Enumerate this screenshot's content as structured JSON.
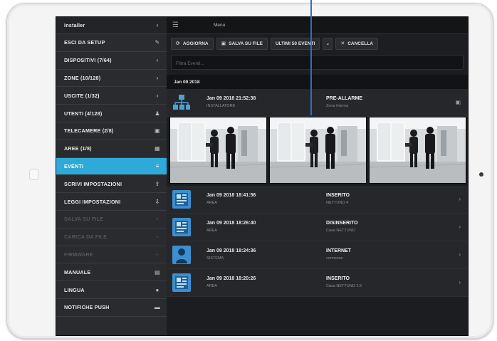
{
  "sidebar": {
    "header": "Installer",
    "items": [
      {
        "label": "ESCI DA SETUP",
        "icon": "tools-icon",
        "glyph": "✎",
        "state": "normal"
      },
      {
        "label": "DISPOSITIVI (7/64)",
        "icon": "chevron-right-icon",
        "glyph": "›",
        "state": "normal"
      },
      {
        "label": "ZONE (10/128)",
        "icon": "chevron-right-icon",
        "glyph": "›",
        "state": "normal"
      },
      {
        "label": "USCITE (1/32)",
        "icon": "chevron-right-icon",
        "glyph": "›",
        "state": "normal"
      },
      {
        "label": "UTENTI (4/128)",
        "icon": "user-icon",
        "glyph": "♟",
        "state": "normal"
      },
      {
        "label": "TELECAMERE (2/8)",
        "icon": "camera-icon",
        "glyph": "▣",
        "state": "normal"
      },
      {
        "label": "AREE (1/8)",
        "icon": "grid-icon",
        "glyph": "▦",
        "state": "normal"
      },
      {
        "label": "EVENTI",
        "icon": "list-icon",
        "glyph": "≡",
        "state": "active"
      },
      {
        "label": "SCRIVI IMPOSTAZIONI",
        "icon": "upload-icon",
        "glyph": "⇪",
        "state": "normal"
      },
      {
        "label": "LEGGI IMPOSTAZIONI",
        "icon": "download-icon",
        "glyph": "⇩",
        "state": "normal"
      },
      {
        "label": "SALVA SU FILE",
        "icon": "save-icon",
        "glyph": "▪",
        "state": "disabled"
      },
      {
        "label": "CARICA DA FILE",
        "icon": "folder-icon",
        "glyph": "▪",
        "state": "disabled"
      },
      {
        "label": "FIRMWARE",
        "icon": "chip-icon",
        "glyph": "▪",
        "state": "disabled"
      },
      {
        "label": "MANUALE",
        "icon": "book-icon",
        "glyph": "▤",
        "state": "normal"
      },
      {
        "label": "LINGUA",
        "icon": "globe-icon",
        "glyph": "●",
        "state": "normal"
      },
      {
        "label": "NOTIFICHE PUSH",
        "icon": "bubble-icon",
        "glyph": "▬",
        "state": "normal"
      }
    ]
  },
  "topbar": {
    "title": "Menu",
    "menu_icon": "hamburger-icon"
  },
  "toolbar": {
    "refresh_label": "AGGIORNA",
    "save_label": "SALVA SU FILE",
    "last_events_label": "ULTIMI 50 EVENTI",
    "delete_label": "CANCELLA"
  },
  "filter": {
    "placeholder": "Filtra Eventi..."
  },
  "date_header": "Jan 09 2018",
  "events": [
    {
      "time": "Jan 09 2018 21:52:38",
      "who": "INSTALLATORE",
      "type": "PRE-ALLARME",
      "sub": "Zona Interna",
      "icon": "alarm-network-icon",
      "has_photos": true
    },
    {
      "time": "Jan 09 2018 18:41:56",
      "who": "AREA",
      "type": "INSERITO",
      "sub": "NETTUNO 4",
      "icon": "panel-icon"
    },
    {
      "time": "Jan 09 2018 18:26:40",
      "who": "AREA",
      "type": "DISINSERITO",
      "sub": "Casa NETTUNO",
      "icon": "panel-icon"
    },
    {
      "time": "Jan 09 2018 18:24:36",
      "who": "SISTEMA",
      "type": "INTERNET",
      "sub": "connesso",
      "icon": "user-icon"
    },
    {
      "time": "Jan 09 2018 18:20:26",
      "who": "AREA",
      "type": "INSERITO",
      "sub": "Casa NETTUNO 2.5",
      "icon": "panel-icon"
    }
  ],
  "colors": {
    "accent": "#2ea9d8",
    "sidebar_bg": "#2a2b2e",
    "screen_bg": "#1c1d20",
    "callout_line": "#2a6fc9"
  }
}
